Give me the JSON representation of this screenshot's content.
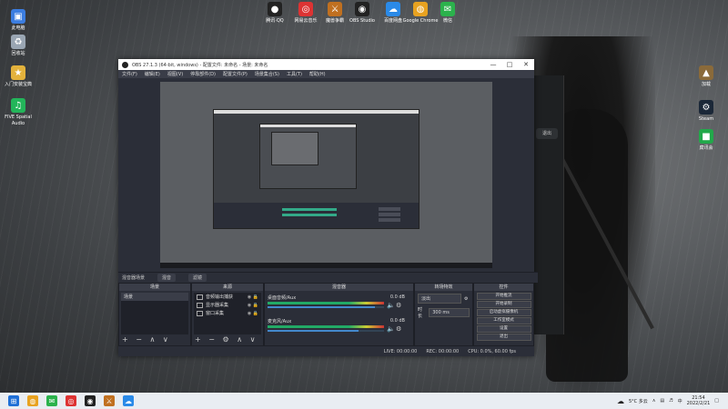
{
  "desktop": {
    "left_icons": [
      {
        "label": "此电脑",
        "icon": "computer-icon",
        "color": "#3b7de0",
        "glyph": "▣"
      },
      {
        "label": "回收站",
        "icon": "recycle-bin-icon",
        "color": "#9aa6b3",
        "glyph": "♻"
      },
      {
        "label": "入门安装宝典",
        "icon": "guide-icon",
        "color": "#e3b23c",
        "glyph": "★"
      },
      {
        "label": "FIVE Spatial Audio",
        "icon": "audio-app-icon",
        "color": "#23b55a",
        "glyph": "♫"
      }
    ],
    "top_icons": [
      {
        "label": "腾讯·QQ",
        "icon": "qq-icon",
        "color": "#222",
        "glyph": "●"
      },
      {
        "label": "网易云音乐",
        "icon": "netease-music-icon",
        "color": "#d33",
        "glyph": "◎"
      },
      {
        "label": "魔兽争霸",
        "icon": "game-icon",
        "color": "#c07020",
        "glyph": "⚔"
      },
      {
        "label": "OBS Studio",
        "icon": "obs-icon",
        "color": "#222",
        "glyph": "◉"
      },
      {
        "label": "百度网盘",
        "icon": "baidu-netdisk-icon",
        "color": "#2a8ae8",
        "glyph": "☁"
      },
      {
        "label": "Google Chrome",
        "icon": "chrome-icon",
        "color": "#e8a220",
        "glyph": "◍"
      },
      {
        "label": "微信",
        "icon": "wechat-icon",
        "color": "#2bb24c",
        "glyph": "✉"
      }
    ],
    "right_icons": [
      {
        "label": "加载",
        "icon": "loader-icon",
        "color": "#8a6a3a",
        "glyph": "▲"
      },
      {
        "label": "Steam",
        "icon": "steam-icon",
        "color": "#1b2838",
        "glyph": "⚙"
      },
      {
        "label": "腐讯会",
        "icon": "meeting-icon",
        "color": "#22a84a",
        "glyph": "■"
      }
    ]
  },
  "obs": {
    "title": "OBS 27.1.3 (64-bit, windows) - 配置文件: 未命名 - 场景: 未命名",
    "menu": [
      "文件(F)",
      "编辑(E)",
      "视图(V)",
      "停靠部件(D)",
      "配置文件(P)",
      "场景集合(S)",
      "工具(T)",
      "帮助(H)"
    ],
    "dock_tabs": {
      "scene_label": "混音器场景",
      "tab1": "混音",
      "tab2": "滤镜"
    },
    "scenes": {
      "header": "场景",
      "items": [
        "场景"
      ],
      "footer": "+ − ∧ ∨"
    },
    "sources": {
      "header": "来源",
      "items": [
        "音频输出捕获",
        "显示器采集",
        "窗口采集"
      ],
      "footer": "+ − ⚙ ∧ ∨"
    },
    "mixer": {
      "header": "混音器",
      "channels": [
        {
          "name": "桌面音频/Aux",
          "db": "0.0 dB",
          "level": 0.92
        },
        {
          "name": "麦克风/Aux",
          "db": "0.0 dB",
          "level": 0.78
        }
      ]
    },
    "transitions": {
      "header": "转场特效",
      "type": "淡出",
      "duration_label": "时长",
      "duration_value": "300 ms"
    },
    "controls": {
      "header": "控件",
      "buttons": [
        "开始推流",
        "开始录制",
        "启动虚拟摄像机",
        "工作室模式",
        "设置",
        "退出"
      ]
    },
    "status": {
      "live": "LIVE: 00:00:00",
      "rec": "REC: 00:00:00",
      "cpu": "CPU: 0.0%, 60.00 fps"
    }
  },
  "side_app": {
    "button": "退出"
  },
  "taskbar": {
    "icons": [
      {
        "icon": "windows-start-icon",
        "color": "#1f6fd6",
        "glyph": "⊞"
      },
      {
        "icon": "chrome-icon",
        "color": "#e8a220",
        "glyph": "◍"
      },
      {
        "icon": "wechat-icon",
        "color": "#2bb24c",
        "glyph": "✉"
      },
      {
        "icon": "netease-music-icon",
        "color": "#d33",
        "glyph": "◎"
      },
      {
        "icon": "obs-icon",
        "color": "#222",
        "glyph": "◉"
      },
      {
        "icon": "game-icon",
        "color": "#c07020",
        "glyph": "⚔"
      },
      {
        "icon": "baidu-netdisk-icon",
        "color": "#2a8ae8",
        "glyph": "☁"
      }
    ],
    "weather": "5°C 多云",
    "ime": "中",
    "time": "21:54",
    "date": "2022/2/21"
  }
}
